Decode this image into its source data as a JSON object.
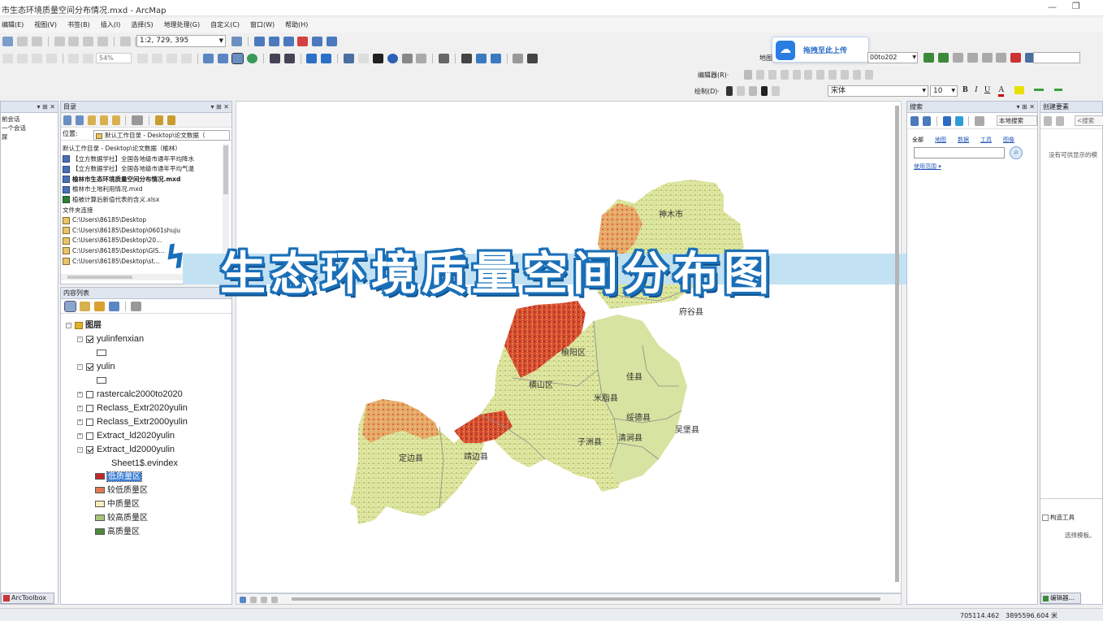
{
  "window": {
    "title": "市生态环境质量空间分布情况.mxd - ArcMap"
  },
  "menu": [
    "编辑(E)",
    "视图(V)",
    "书签(B)",
    "插入(I)",
    "选择(S)",
    "地理处理(G)",
    "自定义(C)",
    "窗口(W)",
    "帮助(H)"
  ],
  "toolbar": {
    "scale": "1:2, 729, 395",
    "zoom": "54%",
    "font_name": "宋体",
    "font_size": "10",
    "edit_label": "编辑器(R)·",
    "draw_label": "绘制(D)·",
    "layer_field": "地图",
    "layer_value": "00to202"
  },
  "upload": {
    "label": "拖拽至此上传"
  },
  "left_strip": {
    "items": [
      "前会话",
      "一个会话",
      "尿"
    ],
    "arctoolbox": "ArcToolbox"
  },
  "catalog": {
    "title": "目录",
    "location_label": "位置:",
    "location_value": "默认工作目录 - Desktop\\论文数据（",
    "items": [
      {
        "text": "默认工作目录 - Desktop\\论文数据（榆林）",
        "icon": "none"
      },
      {
        "text": "【立方数据学社】全国各地级市通年平均降水",
        "icon": "mxd"
      },
      {
        "text": "【立方数据学社】全国各地级市通年平均气温",
        "icon": "mxd"
      },
      {
        "text": "榆林市生态环境质量空间分布情况.mxd",
        "icon": "mxd",
        "bold": true
      },
      {
        "text": "榆林市土地利用情况.mxd",
        "icon": "mxd"
      },
      {
        "text": "植被计算后新值代表的含义.xlsx",
        "icon": "xls"
      },
      {
        "text": "文件夹连接",
        "icon": "none"
      },
      {
        "text": "C:\\Users\\86185\\Desktop",
        "icon": "folder"
      },
      {
        "text": "C:\\Users\\86185\\Desktop\\0601shuju",
        "icon": "folder"
      },
      {
        "text": "C:\\Users\\86185\\Desktop\\20...",
        "icon": "folder"
      },
      {
        "text": "C:\\Users\\86185\\Desktop\\GIS...",
        "icon": "folder"
      },
      {
        "text": "C:\\Users\\86185\\Desktop\\st...",
        "icon": "folder"
      }
    ]
  },
  "toc": {
    "title": "内容列表",
    "root": "图层",
    "layers": [
      {
        "name": "yulinfenxian",
        "checked": true,
        "expanded": true
      },
      {
        "name": "yulin",
        "checked": true,
        "expanded": true
      },
      {
        "name": "rastercalc2000to2020",
        "checked": false,
        "expanded": false
      },
      {
        "name": "Reclass_Extr2020yulin",
        "checked": false,
        "expanded": false
      },
      {
        "name": "Reclass_Extr2000yulin",
        "checked": false,
        "expanded": false
      },
      {
        "name": "Extract_ld2020yulin",
        "checked": false,
        "expanded": false
      },
      {
        "name": "Extract_ld2000yulin",
        "checked": true,
        "expanded": true
      }
    ],
    "legend_field": "Sheet1$.evindex",
    "legend": [
      {
        "label": "低质量区",
        "color": "#c0282a",
        "selected": true
      },
      {
        "label": "较低质量区",
        "color": "#e07a50"
      },
      {
        "label": "中质量区",
        "color": "#f5f0b8"
      },
      {
        "label": "较高质量区",
        "color": "#a8c67a"
      },
      {
        "label": "高质量区",
        "color": "#4e8a3a"
      }
    ]
  },
  "banner": {
    "text": "生态环境质量空间分布图"
  },
  "map": {
    "labels": [
      "神木市",
      "府谷县",
      "横山区",
      "佳县",
      "米脂县",
      "绥德县",
      "子洲县",
      "清涧县",
      "吴堡县",
      "靖边县",
      "定边县",
      "榆阳区"
    ]
  },
  "search": {
    "title": "搜索",
    "scope": "本地搜索",
    "tabs": [
      "全部",
      "地图",
      "数据",
      "工具",
      "图像"
    ],
    "link": "使用范围 ▾"
  },
  "create_features": {
    "title": "创建要素",
    "empty_text": "没有可供显示的模",
    "search_placeholder": "<搜索",
    "construct_title": "构造工具",
    "construct_text": "选择模板。",
    "bottom_tab": "编辑器..."
  },
  "status": {
    "coords": "705114.462   3895596.604 米"
  }
}
